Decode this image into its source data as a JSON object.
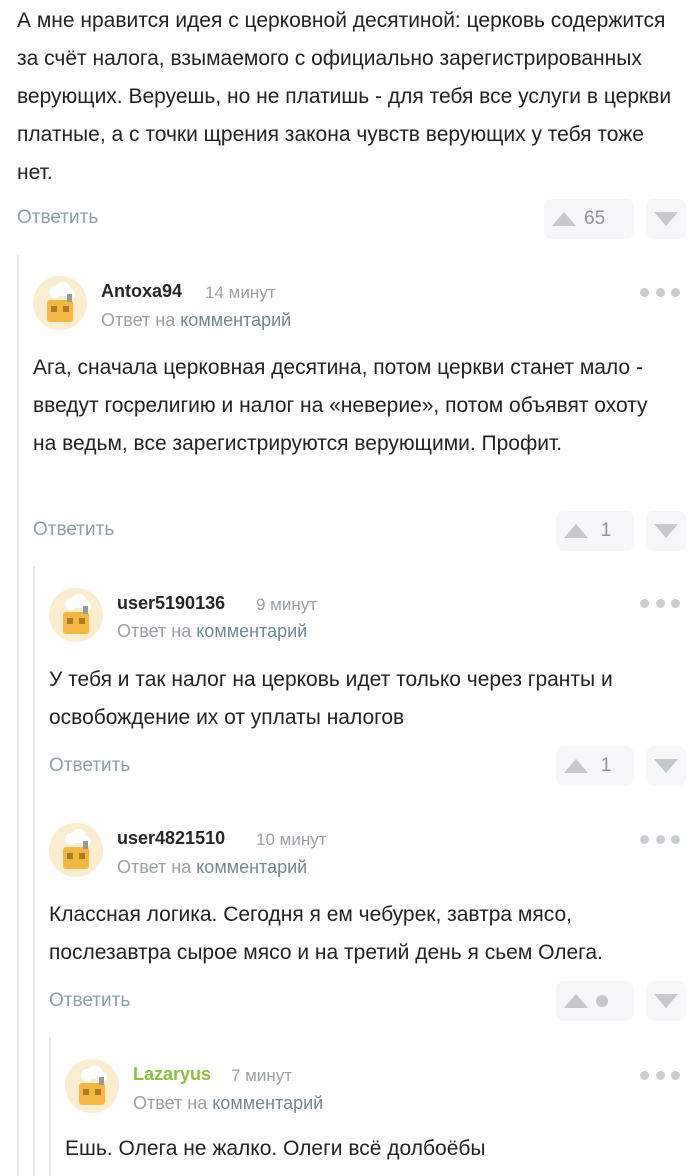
{
  "top_comment": {
    "text": "А мне нравится идея с церковной десятиной: церковь содержится за счёт налога, взымаемого с официально зарегистрированных верующих. Веруешь, но не платишь - для тебя все услуги в церкви платные, а с точки щрения закона чувств верующих у тебя тоже нет.",
    "reply_label": "Ответить",
    "rating": "65"
  },
  "comments": [
    {
      "username": "Antoxa94",
      "time": "14 минут",
      "reply_to_prefix": "Ответ на",
      "reply_to_link": "комментарий",
      "text": "Ага, сначала церковная десятина, потом церкви станет мало - введут госрелигию и налог на «неверие», потом объявят охоту на ведьм, все зарегистрируются верующими. Профит.",
      "reply_label": "Ответить",
      "rating": "1"
    },
    {
      "username": "user5190136",
      "time": "9 минут",
      "reply_to_prefix": "Ответ на",
      "reply_to_link": "комментарий",
      "text": "У тебя и так налог на церковь идет только через гранты и освобождение их от уплаты налогов",
      "reply_label": "Ответить",
      "rating": "1"
    },
    {
      "username": "user4821510",
      "time": "10 минут",
      "reply_to_prefix": "Ответ на",
      "reply_to_link": "комментарий",
      "text": "Классная логика. Сегодня я ем чебурек, завтра мясо, послезавтра сырое мясо и на третий день я сьем Олега.",
      "reply_label": "Ответить",
      "rating": ""
    },
    {
      "username": "Lazaryus",
      "time": "7 минут",
      "reply_to_prefix": "Ответ на",
      "reply_to_link": "комментарий",
      "text": "Ешь. Олега не жалко. Олеги всё долбоёбы",
      "username_color": "#8ac23c"
    }
  ],
  "icons": {
    "vote_up": "triangle-up-icon",
    "vote_down": "triangle-down-icon",
    "more": "more-dots-icon",
    "avatar": "default-avatar-icon"
  },
  "colors": {
    "link": "#6f8a92",
    "muted": "#9aa1a6",
    "accent_user": "#8ac23c"
  }
}
